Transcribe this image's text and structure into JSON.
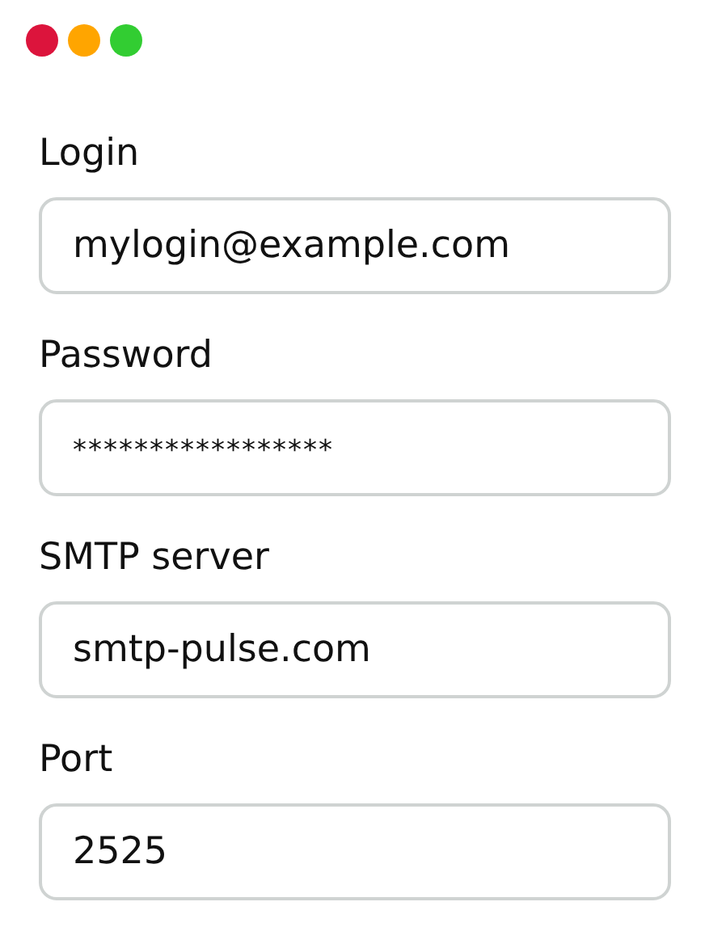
{
  "window_controls": [
    {
      "color": "#dc143c"
    },
    {
      "color": "#ffa500"
    },
    {
      "color": "#32cd32"
    }
  ],
  "fields": [
    {
      "label": "Login",
      "value": "mylogin@example.com",
      "kind": "text"
    },
    {
      "label": "Password",
      "value": "*****************",
      "kind": "password"
    },
    {
      "label": "SMTP server",
      "value": "smtp-pulse.com",
      "kind": "text"
    },
    {
      "label": "Port",
      "value": "2525",
      "kind": "text"
    }
  ]
}
